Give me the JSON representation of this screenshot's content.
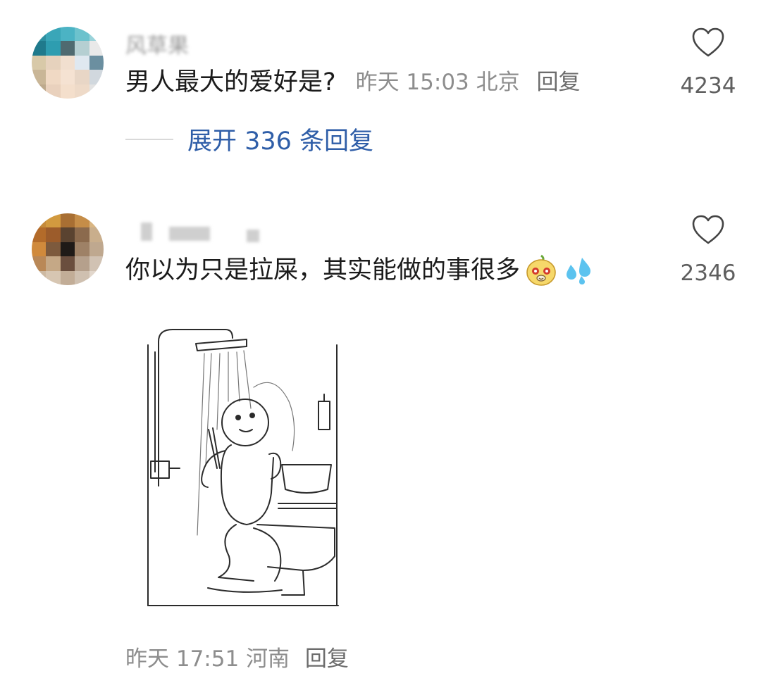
{
  "comments": [
    {
      "username": "风草果",
      "text": "男人最大的爱好是?",
      "time": "昨天 15:03",
      "location": "北京",
      "reply_label": "回复",
      "like_count": "4234",
      "expand_label": "展开 336 条回复"
    },
    {
      "username": "",
      "text": "你以为只是拉屎，其实能做的事很多",
      "like_count": "2346",
      "time": "昨天 17:51",
      "location": "河南",
      "reply_label": "回复"
    }
  ],
  "icons": {
    "like": "heart-outline-icon",
    "emoji_1": "yellow-cartoon-face-emoji",
    "emoji_2": "sweat-droplets-emoji",
    "attachment": "shower-toilet-cartoon-image"
  },
  "colors": {
    "link_blue": "#2f5ea8",
    "meta_gray": "#8d8d8d",
    "text": "#1b1b1b"
  }
}
